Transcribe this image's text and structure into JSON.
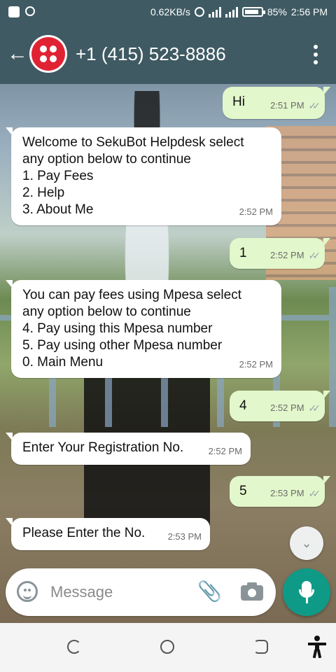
{
  "status_bar": {
    "speed": "0.62KB/s",
    "battery": "85%",
    "battery_level": 0.85,
    "time": "2:56 PM"
  },
  "app_bar": {
    "back_icon": "arrow-left-icon",
    "contact_name": "+1 (415) 523-8886",
    "menu_icon": "more-vertical-icon"
  },
  "messages": [
    {
      "direction": "out",
      "text": "Hi",
      "time": "2:51 PM",
      "status": "read"
    },
    {
      "direction": "in",
      "text": "Welcome to SekuBot Helpdesk select\nany option below to continue\n1. Pay Fees\n2. Help\n3. About Me",
      "time": "2:52 PM"
    },
    {
      "direction": "out",
      "text": "1",
      "time": "2:52 PM",
      "status": "read"
    },
    {
      "direction": "in",
      "text": "You can pay fees using Mpesa select\nany option below to continue\n4. Pay using this Mpesa number\n5. Pay using other Mpesa number\n0. Main Menu",
      "time": "2:52 PM"
    },
    {
      "direction": "out",
      "text": "4",
      "time": "2:52 PM",
      "status": "read"
    },
    {
      "direction": "in",
      "text": "Enter Your Registration No.",
      "time": "2:52 PM"
    },
    {
      "direction": "out",
      "text": "5",
      "time": "2:53 PM",
      "status": "read"
    },
    {
      "direction": "in",
      "text": "Please Enter the No.",
      "time": "2:53 PM"
    }
  ],
  "composer": {
    "placeholder": "Message"
  },
  "colors": {
    "header": "#3f5a63",
    "incoming_bubble": "#ffffff",
    "outgoing_bubble": "#e2f7cb",
    "mic_button": "#0f9a87",
    "avatar": "#e02333"
  }
}
